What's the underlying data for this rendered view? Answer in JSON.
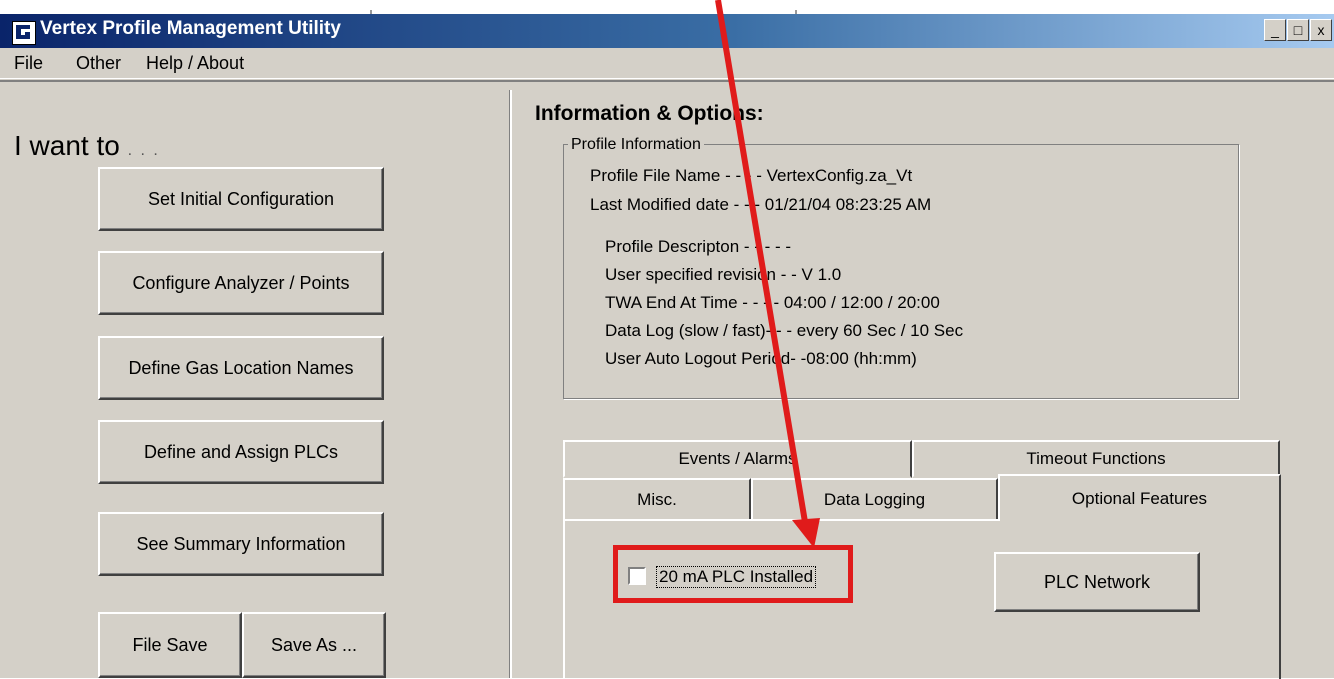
{
  "window": {
    "title": "Vertex Profile Management Utility",
    "controls": [
      "_",
      "□",
      "x"
    ]
  },
  "menu": [
    "File",
    "Other",
    "Help / About"
  ],
  "left_panel": {
    "heading": "I want to",
    "heading_dots": ". . .",
    "buttons": [
      "Set  Initial  Configuration",
      "Configure  Analyzer / Points",
      "Define Gas Location Names",
      "Define and Assign PLCs",
      "See  Summary  Information",
      "File Save",
      "Save As ..."
    ]
  },
  "info": {
    "heading": "Information & Options:",
    "group_title": "Profile Information",
    "lines": [
      "Profile File Name - - - -  VertexConfig.za_Vt",
      "Last Modified date - - -  01/21/04 08:23:25 AM",
      "Profile Descripton - - - - -",
      "User specified revision  - - V 1.0",
      "TWA End At Time  - - - -  04:00  /  12:00  /  20:00",
      "Data  Log (slow / fast)-  - - every 60 Sec / 10 Sec",
      "User Auto Logout Period-  -08:00 (hh:mm)"
    ]
  },
  "tabs": {
    "back_row": [
      "Events / Alarms",
      "Timeout Functions"
    ],
    "front_row": [
      "Misc.",
      "Data Logging",
      "Optional Features"
    ],
    "active": "Optional Features"
  },
  "optional_features": {
    "checkbox_label": "20 mA PLC Installed",
    "checkbox_checked": false,
    "plc_button": "PLC Network"
  },
  "annotation": {
    "color": "#e01b1b"
  }
}
